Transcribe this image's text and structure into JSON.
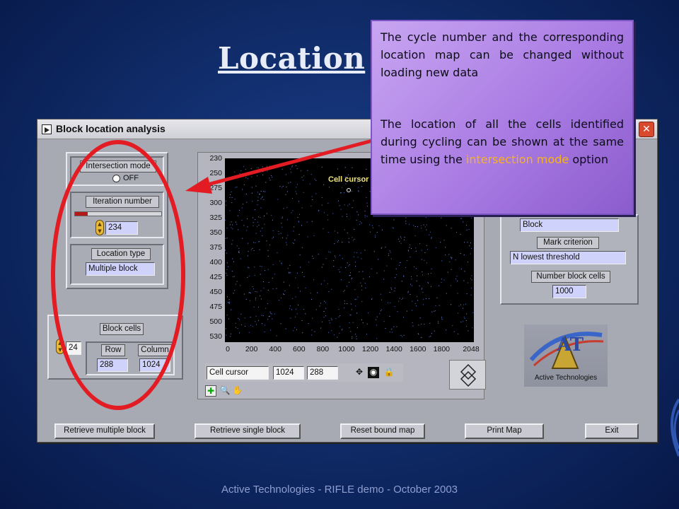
{
  "slide": {
    "title": "Location",
    "footer": "Active Technologies - RIFLE demo - October 2003"
  },
  "window": {
    "title": "Block location analysis",
    "close_label": "✕"
  },
  "left_panel": {
    "intersection_mode_label": "Intersection mode",
    "intersection_mode_value": "OFF",
    "iteration_number_label": "Iteration number",
    "iteration_number_value": "234",
    "iteration_slider_fraction": 0.15,
    "location_type_label": "Location type",
    "location_type_value": "Multiple block"
  },
  "block_cells_panel": {
    "label": "Block cells",
    "count_value": "24",
    "row_label": "Row",
    "row_value": "288",
    "column_label": "Column",
    "column_value": "1024"
  },
  "right_panel": {
    "block_value": "Block",
    "mark_criterion_label": "Mark criterion",
    "mark_criterion_value": "N lowest threshold",
    "number_block_cells_label": "Number block cells",
    "number_block_cells_value": "1000"
  },
  "graph": {
    "y_ticks": [
      "230",
      "250",
      "275",
      "300",
      "325",
      "350",
      "375",
      "400",
      "425",
      "450",
      "475",
      "500",
      "530"
    ],
    "x_ticks": [
      "0",
      "200",
      "400",
      "600",
      "800",
      "1000",
      "1200",
      "1400",
      "1600",
      "1800",
      "2048"
    ],
    "cursor_label": "Cell cursor",
    "cursor_name": "Cell cursor",
    "cursor_x": "1024",
    "cursor_y": "288"
  },
  "buttons": {
    "retrieve_multiple": "Retrieve multiple block",
    "retrieve_single": "Retrieve single block",
    "reset_bound_map": "Reset bound map",
    "print_map": "Print Map",
    "exit": "Exit"
  },
  "logo": {
    "initials": "AT",
    "caption": "Active Technologies"
  },
  "callout": {
    "paragraph1": "The cycle number and the corresponding location map can be changed without loading new data",
    "paragraph2_before": "The location of all the cells identified during cycling can be shown at the same time using the",
    "paragraph2_highlight": "intersection mode",
    "paragraph2_after": "option"
  },
  "colors": {
    "callout_highlight": "#f7b31f",
    "annotation_red": "#e31b23"
  }
}
